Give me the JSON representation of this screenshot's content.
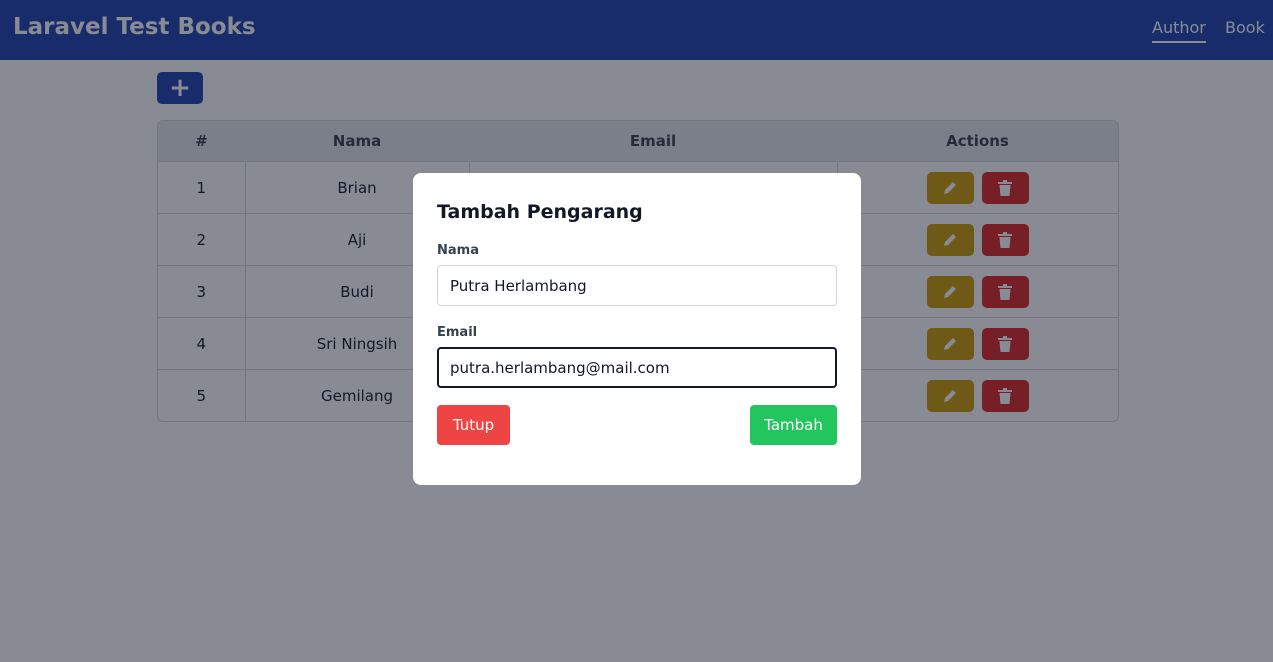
{
  "navbar": {
    "brand": "Laravel Test Books",
    "links": [
      {
        "label": "Author",
        "active": true
      },
      {
        "label": "Book",
        "active": false
      }
    ]
  },
  "toolbar": {
    "add_label": "+"
  },
  "table": {
    "columns": [
      "#",
      "Nama",
      "Email",
      "Actions"
    ],
    "rows": [
      {
        "no": "1",
        "nama": "Brian",
        "email": ""
      },
      {
        "no": "2",
        "nama": "Aji",
        "email": ""
      },
      {
        "no": "3",
        "nama": "Budi",
        "email": ""
      },
      {
        "no": "4",
        "nama": "Sri Ningsih",
        "email": ""
      },
      {
        "no": "5",
        "nama": "Gemilang",
        "email": ""
      }
    ],
    "edit_icon": "pencil-icon",
    "delete_icon": "trash-icon"
  },
  "modal": {
    "title": "Tambah Pengarang",
    "nama_label": "Nama",
    "nama_value": "Putra Herlambang",
    "email_label": "Email",
    "email_value": "putra.herlambang@mail.com",
    "close_label": "Tutup",
    "submit_label": "Tambah"
  },
  "colors": {
    "navbar": "#1e40af",
    "edit": "#ca9a04",
    "delete": "#dc2626",
    "close": "#ef4444",
    "submit": "#22c55e"
  }
}
